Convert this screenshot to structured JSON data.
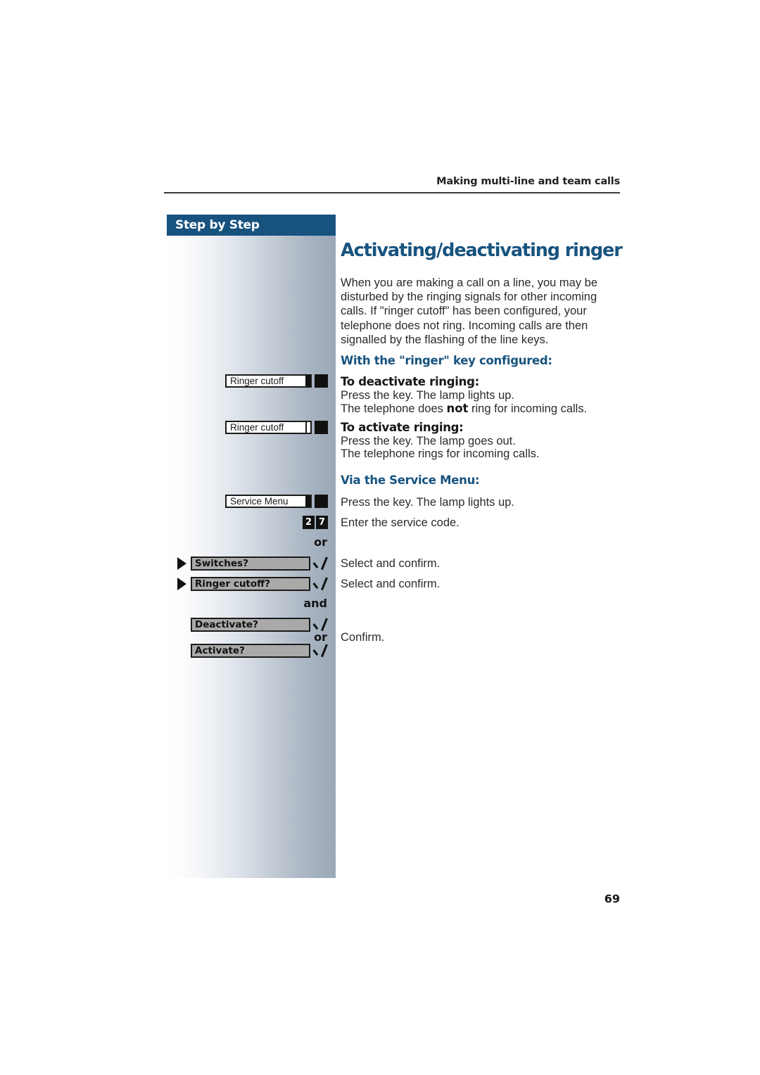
{
  "header": {
    "running_head": "Making multi-line and team calls"
  },
  "sidebar": {
    "title": "Step by Step",
    "keys": [
      {
        "label": "Ringer cutoff",
        "lamp": "on"
      },
      {
        "label": "Ringer cutoff",
        "lamp": "off"
      },
      {
        "label": "Service Menu",
        "lamp": "on"
      }
    ],
    "digit_keys": [
      "2",
      "7"
    ],
    "connectors": {
      "or1": "or",
      "and": "and",
      "or2": "or"
    },
    "menu_options": [
      {
        "label": "Switches?",
        "arrow": true
      },
      {
        "label": "Ringer cutoff?",
        "arrow": true
      },
      {
        "label": "Deactivate?",
        "arrow": false
      },
      {
        "label": "Activate?",
        "arrow": false
      }
    ]
  },
  "main": {
    "title": "Activating/deactivating ringer",
    "intro": "When you are making a call on a line, you may be disturbed by the ringing signals for other incoming calls. If \"ringer cutoff\" has been configured, your telephone does not ring. Incoming calls are then signalled by the flashing of the line keys.",
    "section_ringer_key": "With the \"ringer\" key configured:",
    "deactivate_heading": "To deactivate ringing:",
    "deactivate_line1": "Press the key. The lamp lights up.",
    "deactivate_line2_before": "The telephone does ",
    "deactivate_line2_bold": "not",
    "deactivate_line2_after": " ring for incoming calls.",
    "activate_heading": "To activate ringing:",
    "activate_line1": "Press the key. The lamp goes out.",
    "activate_line2": "The telephone rings for incoming calls.",
    "section_service_menu": "Via the Service Menu:",
    "service_line1": "Press the key. The lamp lights up.",
    "service_line2": "Enter the service code.",
    "select_confirm_1": "Select and confirm.",
    "select_confirm_2": "Select and confirm.",
    "confirm": "Confirm."
  },
  "footer": {
    "page_number": "69"
  },
  "colors": {
    "brand_blue": "#17537f",
    "header_bar": "#18527f",
    "rule": "#3b3b44"
  }
}
